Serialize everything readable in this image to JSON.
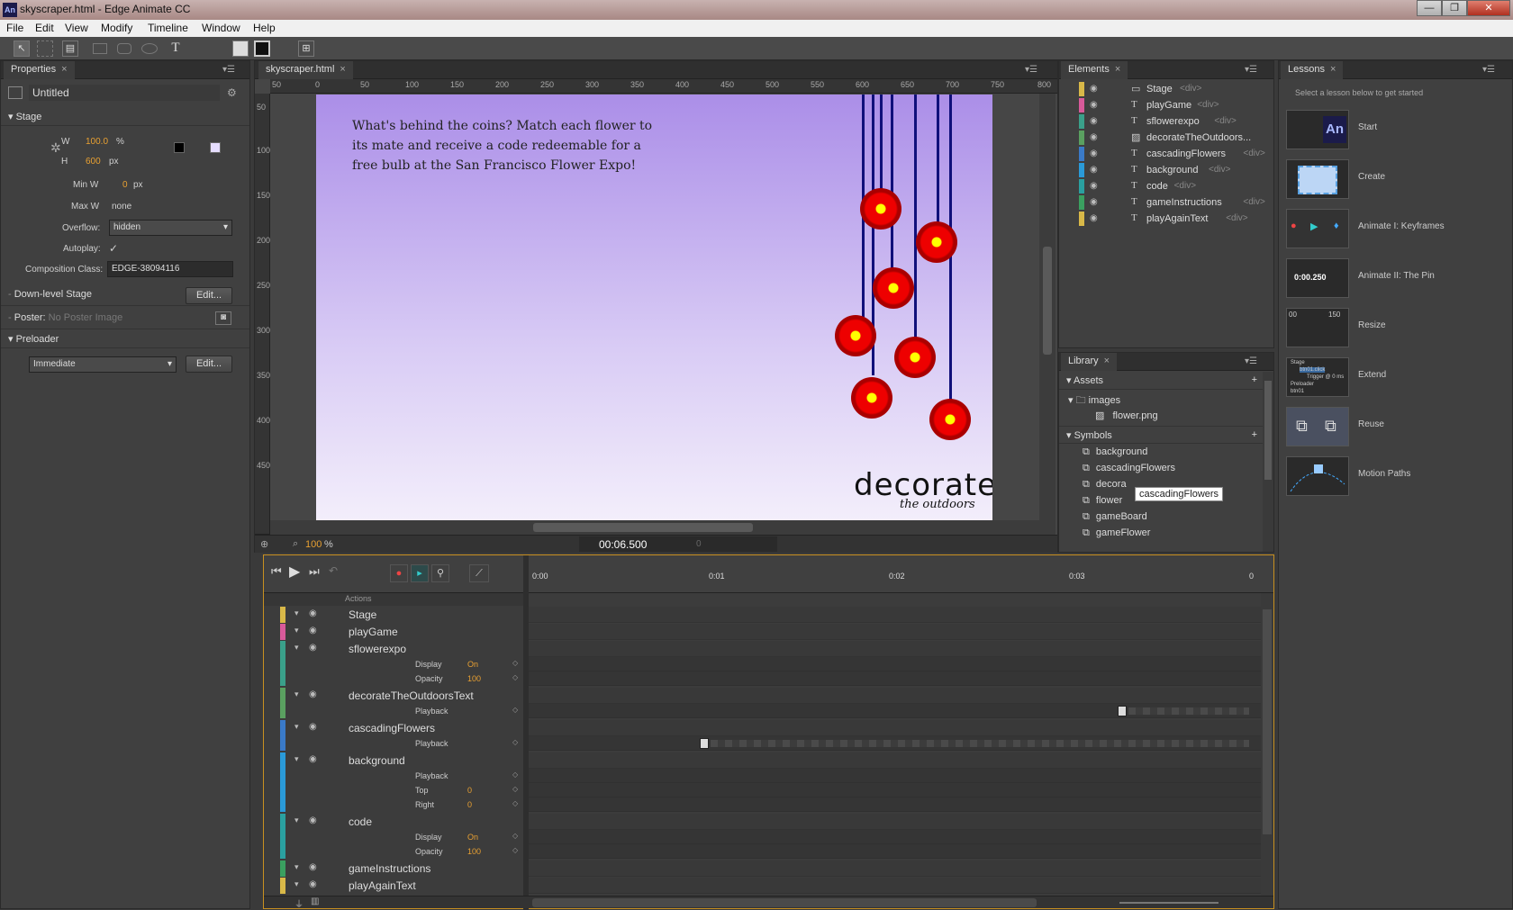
{
  "window": {
    "app_icon": "An",
    "title": "skyscraper.html - Edge Animate CC"
  },
  "menu": [
    "File",
    "Edit",
    "View",
    "Modify",
    "Timeline",
    "Window",
    "Help"
  ],
  "toolbar_icons": [
    "selection-tool-icon",
    "transform-tool-icon",
    "clipping-tool-icon",
    "rectangle-tool-icon",
    "rounded-rect-tool-icon",
    "ellipse-tool-icon",
    "text-tool-icon",
    "fill-color-icon",
    "border-color-icon",
    "layout-presets-icon"
  ],
  "properties": {
    "tab": "Properties",
    "name": "Untitled",
    "section_stage": "Stage",
    "w_label": "W",
    "w_value": "100.0",
    "w_unit": "%",
    "h_label": "H",
    "h_value": "600",
    "h_unit": "px",
    "minw_label": "Min W",
    "minw_value": "0",
    "minw_unit": "px",
    "maxw_label": "Max W",
    "maxw_value": "none",
    "overflow_label": "Overflow:",
    "overflow_value": "hidden",
    "autoplay_label": "Autoplay:",
    "autoplay_checked": "✓",
    "compclass_label": "Composition Class:",
    "compclass_value": "EDGE-38094116",
    "downlevel_label": "Down-level Stage",
    "edit_label": "Edit...",
    "poster_label": "Poster:",
    "poster_value": "No Poster Image",
    "section_preloader": "Preloader",
    "preloader_value": "Immediate",
    "colors": {
      "bg_swatch": "#000000",
      "fill_swatch": "#e6ddff"
    }
  },
  "document": {
    "tab": "skyscraper.html",
    "ruler_h": [
      "50",
      "0",
      "50",
      "100",
      "150",
      "200",
      "250",
      "300",
      "350",
      "400",
      "450",
      "500",
      "550",
      "600",
      "650",
      "700",
      "750",
      "800"
    ],
    "ruler_v": [
      "50",
      "100",
      "150",
      "200",
      "250",
      "300",
      "350",
      "400",
      "450"
    ],
    "stage_text": "What's behind the coins? Match each flower to its mate and receive a code redeemable for a free bulb at the San Francisco Flower Expo!",
    "logo_main": "decorate",
    "logo_sub": "the outdoors",
    "zoom": "100",
    "zoom_unit": "%",
    "time": "00:06.500",
    "time_right": "0"
  },
  "elements": {
    "tab": "Elements",
    "items": [
      {
        "name": "Stage",
        "tag": "<div>",
        "color": "#d8b848"
      },
      {
        "name": "playGame",
        "tag": "<div>",
        "color": "#d85a9a"
      },
      {
        "name": "sflowerexpo",
        "tag": "<div>",
        "color": "#3aa08a"
      },
      {
        "name": "decorateTheOutdoors...",
        "tag": "",
        "color": "#5aa060"
      },
      {
        "name": "cascadingFlowers",
        "tag": "<div>",
        "color": "#3a7ac8"
      },
      {
        "name": "background",
        "tag": "<div>",
        "color": "#2a9ad8"
      },
      {
        "name": "code",
        "tag": "<div>",
        "color": "#2aa0a0"
      },
      {
        "name": "gameInstructions",
        "tag": "<div>",
        "color": "#3aa060"
      },
      {
        "name": "playAgainText",
        "tag": "<div>",
        "color": "#d8b848"
      }
    ]
  },
  "library": {
    "tab": "Library",
    "assets": "Assets",
    "images": "images",
    "image_file": "flower.png",
    "symbols": "Symbols",
    "symbol_items": [
      "background",
      "cascadingFlowers",
      "decora",
      "flower",
      "gameBoard",
      "gameFlower"
    ],
    "tooltip": "cascadingFlowers"
  },
  "lessons": {
    "tab": "Lessons",
    "hint": "Select a lesson below to get started",
    "items": [
      "Start",
      "Create",
      "Animate I: Keyframes",
      "Animate II: The Pin",
      "Resize",
      "Extend",
      "Reuse",
      "Motion Paths"
    ],
    "thumb_text": {
      "pin_time": "0:00.250",
      "resize_a": "00",
      "resize_b": "150",
      "extend_a": "Stage",
      "extend_b": "btn01.click",
      "extend_c": "Trigger @ 0 ms",
      "extend_d": "Preloader",
      "extend_e": "btn01",
      "start_logo": "An"
    }
  },
  "timeline": {
    "time_marks": [
      "0:00",
      "0:01",
      "0:02",
      "0:03",
      "0"
    ],
    "actions": "Actions",
    "rows": [
      {
        "name": "Stage",
        "color": "#d8b848"
      },
      {
        "name": "playGame",
        "color": "#d85a9a"
      },
      {
        "name": "sflowerexpo",
        "color": "#3aa08a",
        "props": [
          [
            "Display",
            "On"
          ],
          [
            "Opacity",
            "100"
          ]
        ]
      },
      {
        "name": "decorateTheOutdoorsText",
        "color": "#5aa060",
        "props": [
          [
            "Playback",
            ""
          ]
        ]
      },
      {
        "name": "cascadingFlowers",
        "color": "#3a7ac8",
        "props": [
          [
            "Playback",
            ""
          ]
        ]
      },
      {
        "name": "background",
        "color": "#2a9ad8",
        "props": [
          [
            "Playback",
            ""
          ],
          [
            "Top",
            "0"
          ],
          [
            "Right",
            "0"
          ]
        ]
      },
      {
        "name": "code",
        "color": "#2aa0a0",
        "props": [
          [
            "Display",
            "On"
          ],
          [
            "Opacity",
            "100"
          ]
        ]
      },
      {
        "name": "gameInstructions",
        "color": "#3aa060"
      },
      {
        "name": "playAgainText",
        "color": "#d8b848"
      }
    ]
  }
}
